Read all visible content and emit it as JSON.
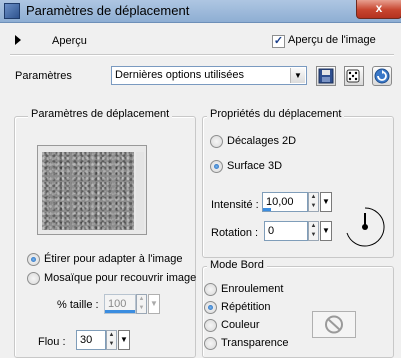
{
  "window": {
    "title": "Paramètres de déplacement",
    "close_label": "x"
  },
  "preview_bar": {
    "apercu_label": "Aperçu",
    "apercu_image_label": "Aperçu de l'image",
    "apercu_image_checked": true
  },
  "params": {
    "label": "Paramètres",
    "selected": "Dernières options utilisées"
  },
  "displacement_params": {
    "legend": "Paramètres de déplacement",
    "option_stretch": "Étirer pour adapter à l'image",
    "option_tile": "Mosaïque pour recouvrir image",
    "size_label": "% taille :",
    "size_value": "100",
    "blur_label": "Flou :",
    "blur_value": "30"
  },
  "displacement_props": {
    "legend": "Propriétés du déplacement",
    "option_offsets": "Décalages 2D",
    "option_surface": "Surface 3D",
    "intensity_label": "Intensité :",
    "intensity_value": "10,00",
    "intensity_level": 0.1,
    "rotation_label": "Rotation :",
    "rotation_value": "0"
  },
  "edge_mode": {
    "legend": "Mode Bord",
    "option_wrap": "Enroulement",
    "option_repeat": "Répétition",
    "option_color": "Couleur",
    "option_transparency": "Transparence"
  }
}
